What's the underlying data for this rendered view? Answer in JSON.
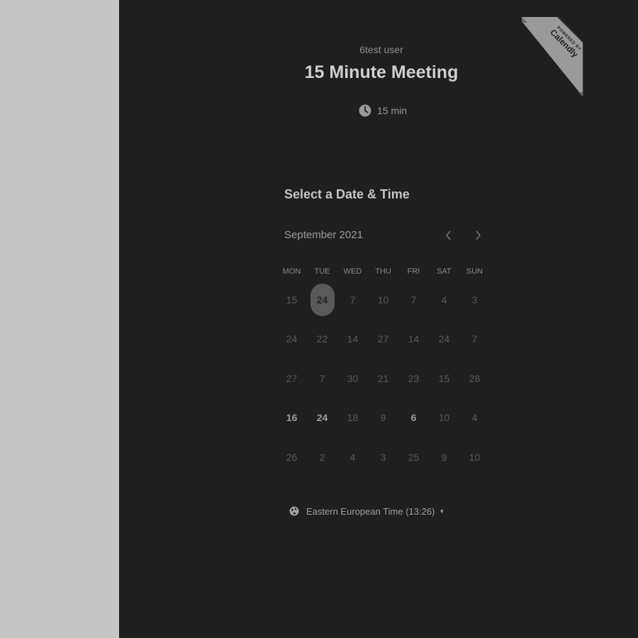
{
  "organizer": "6test user",
  "event": {
    "title": "15 Minute Meeting",
    "duration": "15 min",
    "icon": "clock-icon"
  },
  "badge": {
    "line1": "POWERED BY",
    "brand": "Calendly"
  },
  "calendar": {
    "heading": "Select a Date & Time",
    "month": "September 2021",
    "prev_icon": "chevron-left-icon",
    "next_icon": "chevron-right-icon",
    "weekdays": [
      "MON",
      "TUE",
      "WED",
      "THU",
      "FRI",
      "SAT",
      "SUN"
    ],
    "weeks": [
      [
        "15",
        "24",
        "7",
        "10",
        "7",
        "4",
        "3"
      ],
      [
        "24",
        "22",
        "14",
        "27",
        "14",
        "24",
        "7"
      ],
      [
        "27",
        "7",
        "30",
        "21",
        "23",
        "15",
        "28"
      ],
      [
        "16",
        "24",
        "18",
        "9",
        "6",
        "10",
        "4"
      ],
      [
        "26",
        "2",
        "4",
        "3",
        "25",
        "9",
        "10"
      ]
    ],
    "selected": [
      0,
      1
    ],
    "available": [
      [
        3,
        0
      ],
      [
        3,
        1
      ],
      [
        3,
        4
      ]
    ]
  },
  "timezone": {
    "label": "Eastern European Time (13:26)",
    "icon": "globe-icon"
  },
  "colors": {
    "panel_bg": "#1f1f1f",
    "page_bg": "#c6c6c6",
    "badge_bg": "#9a9a9a"
  }
}
